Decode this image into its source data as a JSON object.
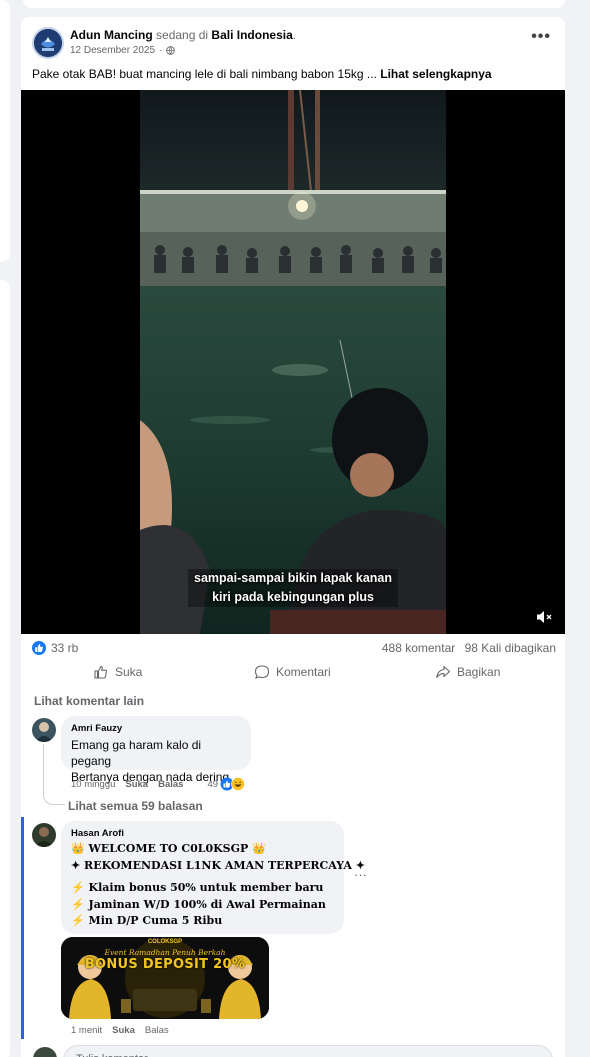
{
  "post": {
    "author": "Adun Mancing",
    "at_text": "sedang di",
    "location": "Bali Indonesia",
    "date": "12 Desember 2025",
    "caption": "Pake otak BAB! buat mancing lele di bali nimbang babon 15kg ...",
    "see_more": "Lihat selengkapnya",
    "more_icon": "more-horizontal-icon"
  },
  "video": {
    "subtitle_line1": "sampai-sampai bikin lapak kanan",
    "subtitle_line2": "kiri pada kebingungan plus",
    "mute_icon": "speaker-muted-icon"
  },
  "stats": {
    "likes": "33 rb",
    "comments": "488 komentar",
    "shares": "98 Kali dibagikan"
  },
  "actions": {
    "like": "Suka",
    "comment": "Komentari",
    "share": "Bagikan"
  },
  "comments_section": {
    "view_more": "Lihat komentar lain",
    "replies_link": "Lihat semua 59 balasan",
    "reply_placeholder": "Tulis komentar..."
  },
  "comments": [
    {
      "name": "Amri Fauzy",
      "line1": "Emang ga haram kalo di pegang",
      "line2": "Bertanya dengan nada dering",
      "time": "10 minggu",
      "like": "Suka",
      "reply": "Balas",
      "reactions": "49"
    },
    {
      "name": "Hasan Arofi",
      "line1": "👑 WELCOME TO C0L0KSGP 👑",
      "line2": "✦ REKOMENDASI L1NK AMAN TERPERCAYA ✦",
      "line3": "⚡ Klaim bonus 50% untuk member baru",
      "line4": "⚡ Jaminan W/D 100% di Awal Permainan",
      "line5": "⚡ Min D/P Cuma 5 Ribu",
      "banner_top": "Event Ramadhan Penuh Berkah",
      "banner_title": "BONUS DEPOSIT 20%",
      "banner_brand": "COLOKSGP",
      "time": "1 menit",
      "like": "Suka",
      "reply": "Balas"
    }
  ],
  "colors": {
    "accent": "#1877f2",
    "highlight_bar": "#2d65c8",
    "banner_gold": "#f2c61f"
  }
}
